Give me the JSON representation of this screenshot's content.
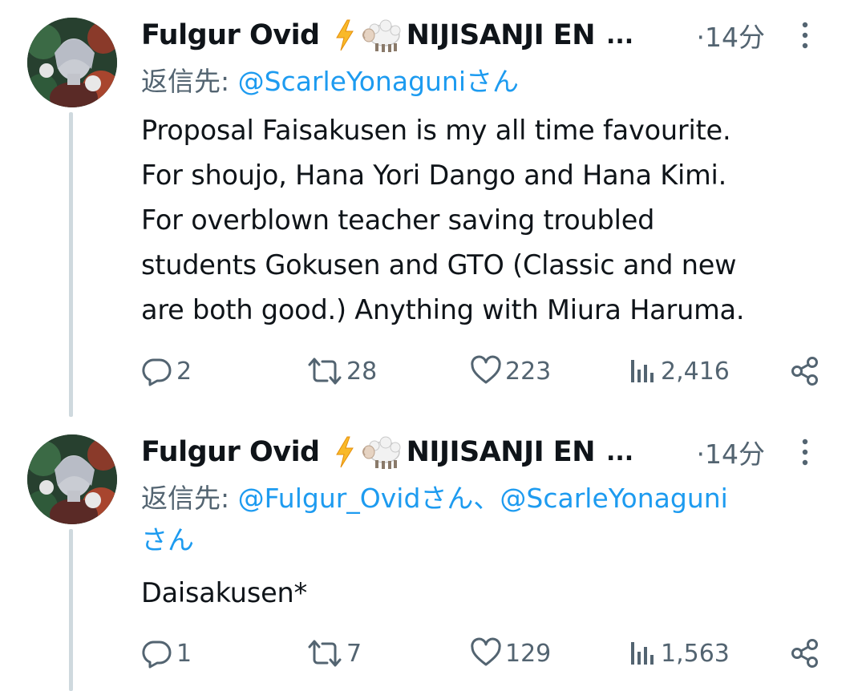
{
  "tweets": [
    {
      "author": {
        "name": "Fulgur Ovid",
        "suffix": "NIJISANJI EN",
        "ellipsis": "...",
        "emoji": [
          "lightning-bolt-emoji",
          "sheep-emoji"
        ]
      },
      "time": "·14分",
      "reply_to": {
        "prefix": "返信先: ",
        "mention1": "@ScarleYonagunisan",
        "mention1_display": "@ScarleYonaguniさん",
        "separator": "",
        "mention2_display": ""
      },
      "text": "Proposal Faisakusen is my all time favourite.\nFor shoujo, Hana Yori Dango and Hana Kimi.\nFor overblown teacher saving troubled\nstudents Gokusen and GTO (Classic and new\nare both good.) Anything with Miura Haruma.",
      "stats": {
        "replies": "2",
        "retweets": "28",
        "likes": "223",
        "views": "2,416"
      }
    },
    {
      "author": {
        "name": "Fulgur Ovid",
        "suffix": "NIJISANJI EN",
        "ellipsis": "...",
        "emoji": [
          "lightning-bolt-emoji",
          "sheep-emoji"
        ]
      },
      "time": "·14分",
      "reply_to": {
        "prefix": "返信先: ",
        "mention1_display": "@Fulgur_Ovidさん",
        "separator": "、",
        "mention2_display": "@ScarleYonaguni",
        "mention2_suffix": "さん"
      },
      "text": "Daisakusen*",
      "stats": {
        "replies": "1",
        "retweets": "7",
        "likes": "129",
        "views": "1,563"
      }
    }
  ],
  "colors": {
    "text": "#0f1419",
    "secondary": "#536471",
    "link": "#1d9bf0",
    "thread_line": "#cfd9de",
    "background": "#ffffff"
  },
  "icons": {
    "reply": "speech-bubble-icon",
    "retweet": "retweet-arrows-icon",
    "like": "heart-outline-icon",
    "views": "bar-chart-icon",
    "share": "share-nodes-icon",
    "more": "vertical-dots-icon"
  }
}
